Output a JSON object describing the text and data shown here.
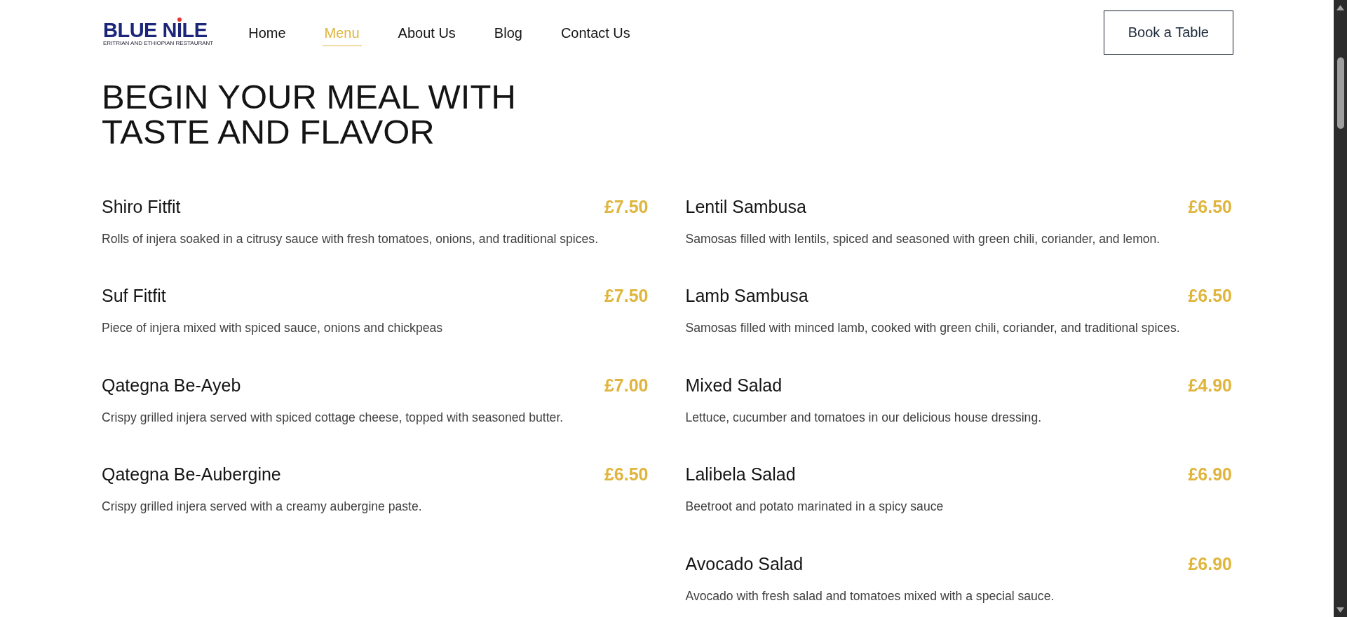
{
  "header": {
    "logo": {
      "wordmark": "BLUE NILE",
      "tagline": "ERITRIAN AND ETHIOPIAN RESTAURANT"
    },
    "nav": [
      {
        "label": "Home",
        "selected": false
      },
      {
        "label": "Menu",
        "selected": true
      },
      {
        "label": "About Us",
        "selected": false
      },
      {
        "label": "Blog",
        "selected": false
      },
      {
        "label": "Contact Us",
        "selected": false
      }
    ],
    "cta": {
      "label": "Book a Table"
    }
  },
  "heading": "BEGIN YOUR MEAL WITH TASTE AND FLAVOR",
  "menu": {
    "columns": [
      {
        "items": [
          {
            "name": "Shiro Fitfit",
            "price": "£7.50",
            "description": "Rolls of injera soaked in a citrusy sauce with fresh tomatoes, onions, and traditional spices."
          },
          {
            "name": "Suf Fitfit",
            "price": "£7.50",
            "description": "Piece of injera mixed with spiced sauce, onions and chickpeas"
          },
          {
            "name": "Qategna Be-Ayeb",
            "price": "£7.00",
            "description": "Crispy grilled injera served with spiced cottage cheese, topped with seasoned butter."
          },
          {
            "name": "Qategna Be-Aubergine",
            "price": "£6.50",
            "description": "Crispy grilled injera served with a creamy aubergine paste."
          }
        ]
      },
      {
        "items": [
          {
            "name": "Lentil Sambusa",
            "price": "£6.50",
            "description": "Samosas filled with lentils, spiced and seasoned with green chili, coriander, and lemon."
          },
          {
            "name": "Lamb Sambusa",
            "price": "£6.50",
            "description": "Samosas filled with minced lamb, cooked with green chili, coriander, and traditional spices."
          },
          {
            "name": "Mixed Salad",
            "price": "£4.90",
            "description": "Lettuce, cucumber and tomatoes in our delicious house dressing."
          },
          {
            "name": "Lalibela Salad",
            "price": "£6.90",
            "description": "Beetroot and potato marinated in a spicy sauce"
          },
          {
            "name": "Avocado Salad",
            "price": "£6.90",
            "description": "Avocado with fresh salad and tomatoes mixed with a special sauce."
          }
        ]
      }
    ]
  }
}
